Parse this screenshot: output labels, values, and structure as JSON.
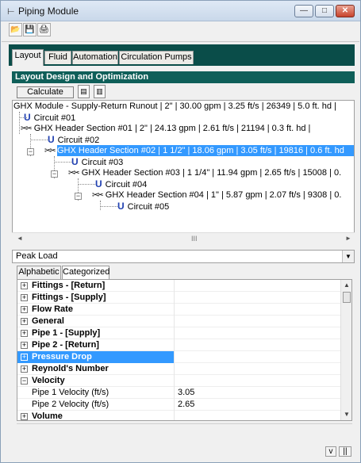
{
  "window": {
    "title": "Piping Module",
    "app_icon": "pipe-app-icon",
    "min_glyph": "—",
    "max_glyph": "□",
    "close_glyph": "✕"
  },
  "toolbar": {
    "icons": [
      "open-folder-icon",
      "save-disk-icon",
      "print-icon"
    ],
    "open_glyph": "📂",
    "save_glyph": "💾",
    "print_glyph": "🖨"
  },
  "tabs": [
    "Layout",
    "Fluid",
    "Automation",
    "Circulation Pumps"
  ],
  "active_tab": "Layout",
  "section_title": "Layout Design and Optimization",
  "calculate_label": "Calculate",
  "tree": {
    "root": "GHX Module - Supply-Return Runout     |  2\"  |  30.00 gpm  |  3.25 ft/s  |  26349  |  5.0 ft. hd  |",
    "nodes": [
      {
        "label": "Circuit #01",
        "kind": "circuit"
      },
      {
        "label": "GHX Header Section #01     |  2\"  |  24.13 gpm  |  2.61 ft/s  |  21194  |  0.3 ft. hd  |",
        "kind": "header"
      },
      {
        "label": "Circuit #02",
        "kind": "circuit"
      },
      {
        "label": "GHX Header Section #02     |  1 1/2\"  |  18.06 gpm  |  3.05 ft/s  |  19816  |  0.6 ft. hd",
        "kind": "header",
        "selected": true
      },
      {
        "label": "Circuit #03",
        "kind": "circuit"
      },
      {
        "label": "GHX Header Section #03     |  1 1/4\"  |  11.94 gpm  |  2.65 ft/s  |  15008  |  0.",
        "kind": "header"
      },
      {
        "label": "Circuit #04",
        "kind": "circuit"
      },
      {
        "label": "GHX Header Section #04     |  1\"  |  5.87 gpm  |  2.07 ft/s  |  9308  |  0.",
        "kind": "header"
      },
      {
        "label": "Circuit #05",
        "kind": "circuit"
      }
    ]
  },
  "glyphs": {
    "u": "U",
    "ghx": "✂✂",
    "plus": "+",
    "minus": "−",
    "left": "◄",
    "right": "►",
    "up": "▲",
    "down": "▼",
    "grip": "III"
  },
  "load_combo": {
    "value": "Peak Load"
  },
  "prop_tabs": [
    "Alphabetic",
    "Categorized"
  ],
  "active_prop_tab": "Categorized",
  "properties": [
    {
      "name": "Fittings - [Return]",
      "type": "category",
      "expanded": false
    },
    {
      "name": "Fittings - [Supply]",
      "type": "category",
      "expanded": false
    },
    {
      "name": "Flow Rate",
      "type": "category",
      "expanded": false
    },
    {
      "name": "General",
      "type": "category",
      "expanded": false
    },
    {
      "name": "Pipe 1 - [Supply]",
      "type": "category",
      "expanded": false
    },
    {
      "name": "Pipe 2 - [Return]",
      "type": "category",
      "expanded": false
    },
    {
      "name": "Pressure Drop",
      "type": "category",
      "expanded": false,
      "highlighted": true
    },
    {
      "name": "Reynold's Number",
      "type": "category",
      "expanded": false
    },
    {
      "name": "Velocity",
      "type": "category",
      "expanded": true
    },
    {
      "name": "Pipe 1 Velocity (ft/s)",
      "type": "property",
      "value": "3.05"
    },
    {
      "name": "Pipe 2 Velocity (ft/s)",
      "type": "property",
      "value": "2.65"
    },
    {
      "name": "Volume",
      "type": "category",
      "expanded": false
    }
  ],
  "bottom_buttons": [
    "v",
    "||"
  ]
}
